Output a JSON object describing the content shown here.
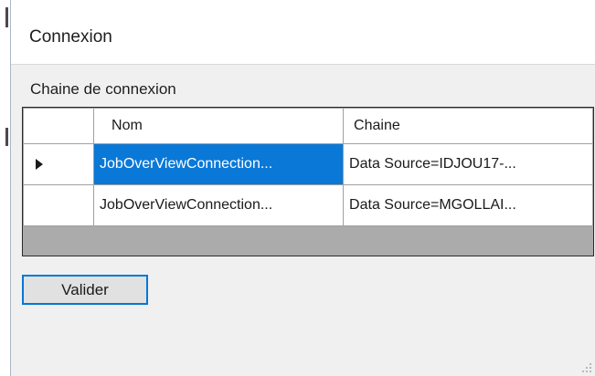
{
  "window": {
    "title": "Connexion"
  },
  "connection_group": {
    "label": "Chaine de connexion"
  },
  "grid": {
    "columns": [
      "Nom",
      "Chaine"
    ],
    "rows": [
      {
        "nom": "JobOverViewConnection...",
        "chaine": "Data Source=IDJOU17-...",
        "selected": true
      },
      {
        "nom": "JobOverViewConnection...",
        "chaine": "Data Source=MGOLLAI...",
        "selected": false
      }
    ],
    "current_row_icon": "row-pointer-arrow-icon"
  },
  "actions": {
    "validate_label": "Valider"
  },
  "colors": {
    "selection": "#0a78d7",
    "button_border": "#0078d7",
    "grid_empty_area": "#ababab"
  }
}
